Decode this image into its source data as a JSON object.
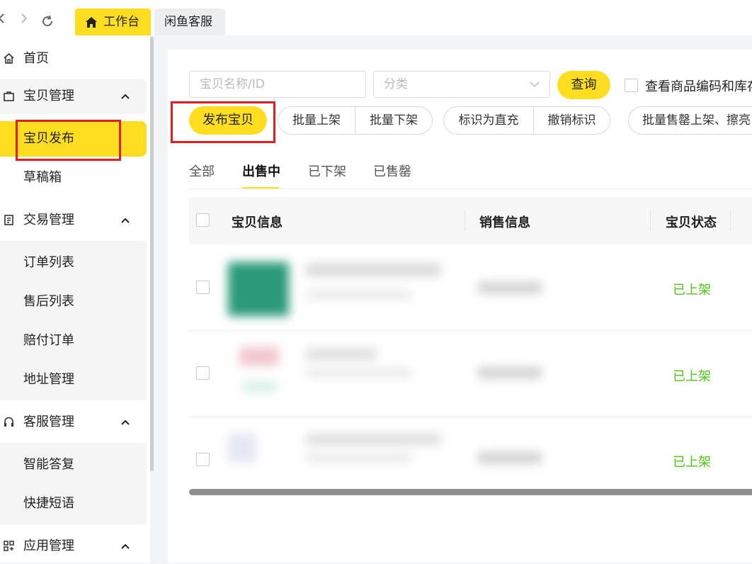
{
  "topbar": {
    "nav_icons": [
      "chevron-left-icon",
      "chevron-right-icon",
      "refresh-icon"
    ],
    "tabs": [
      {
        "label": "工作台",
        "icon": "home-icon",
        "active": true
      },
      {
        "label": "闲鱼客服",
        "active": false
      }
    ]
  },
  "sidebar": {
    "home": "首页",
    "product_mgmt": "宝贝管理",
    "product_publish": "宝贝发布",
    "drafts": "草稿箱",
    "trade_mgmt": "交易管理",
    "order_list": "订单列表",
    "aftersale_list": "售后列表",
    "compensation_orders": "赔付订单",
    "address_mgmt": "地址管理",
    "cs_mgmt": "客服管理",
    "smart_reply": "智能答复",
    "quick_phrases": "快捷短语",
    "app_mgmt": "应用管理"
  },
  "search": {
    "name_placeholder": "宝贝名称/ID",
    "category_placeholder": "分类",
    "query_label": "查询",
    "check_label": "查看商品编码和库存"
  },
  "actions": {
    "publish": "发布宝贝",
    "bulk_on": "批量上架",
    "bulk_off": "批量下架",
    "mark_direct": "标识为直充",
    "unmark": "撤销标识",
    "soldout_bulk": "批量售罄上架、擦亮"
  },
  "status_tabs": [
    "全部",
    "出售中",
    "已下架",
    "已售罄"
  ],
  "active_status_tab": "出售中",
  "table": {
    "headers": [
      "宝贝信息",
      "销售信息",
      "宝贝状态"
    ],
    "rows": [
      {
        "status": "已上架"
      },
      {
        "status": "已上架"
      },
      {
        "status": "已上架"
      }
    ]
  },
  "colors": {
    "accent": "#ffde21",
    "status_green": "#52c41a",
    "highlight_red": "#e0201e"
  }
}
